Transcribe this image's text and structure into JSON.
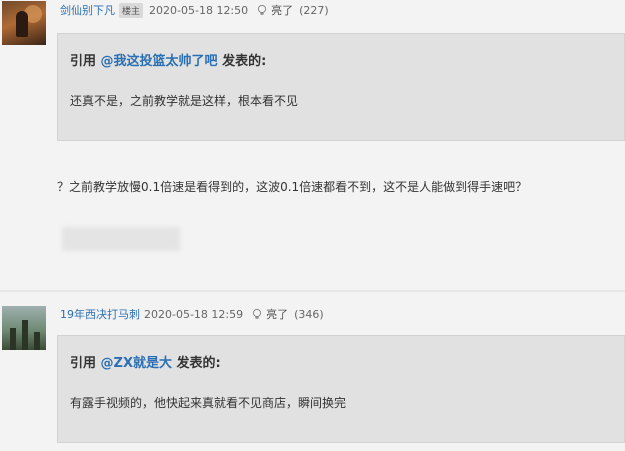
{
  "posts": [
    {
      "username": "剑仙别下凡",
      "badge": "楼主",
      "timestamp": "2020-05-18 12:50",
      "like_label": "亮了",
      "like_count": "(227)",
      "quote": {
        "prefix": "引用 ",
        "user": "@我这投篮太帅了吧",
        "suffix": " 发表的:",
        "body": "还真不是，之前教学就是这样，根本看不见"
      },
      "reply": "？之前教学放慢0.1倍速是看得到的，这波0.1倍速都看不到，这不是人能做到得手速吧？"
    },
    {
      "username": "19年西决打马刺",
      "timestamp": "2020-05-18 12:59",
      "like_label": "亮了",
      "like_count": "(346)",
      "quote": {
        "prefix": "引用 ",
        "user": "@ZX就是大",
        "suffix": " 发表的:",
        "body": "有露手视频的，他快起来真就看不见商店，瞬间换完"
      }
    }
  ],
  "colors": {
    "link": "#2a6fb3",
    "background": "#f3f3f3",
    "quote_bg": "#e1e1e1"
  },
  "icons": {
    "like": "light-bulb-icon"
  }
}
